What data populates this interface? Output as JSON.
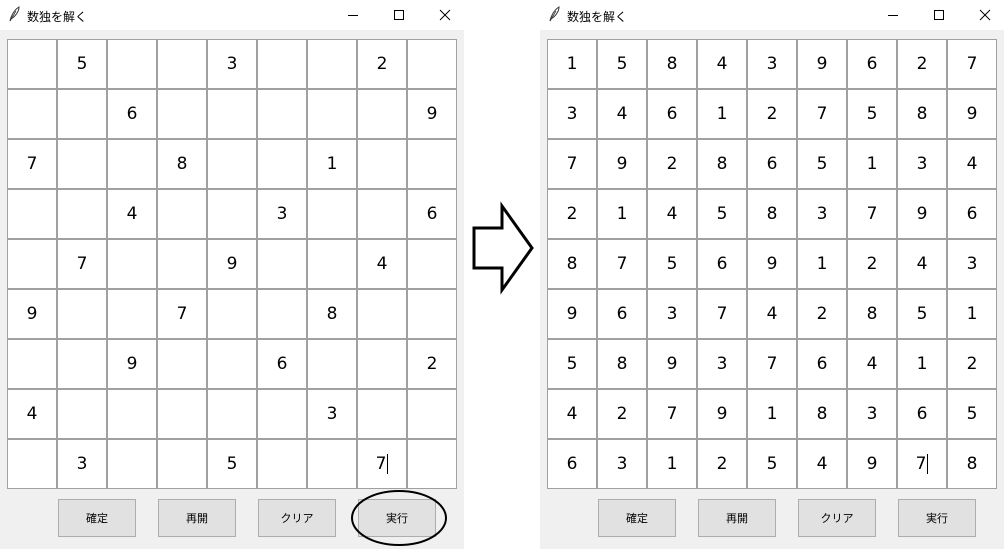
{
  "windows": [
    {
      "title": "数独を解く",
      "grid": [
        [
          "",
          "5",
          "",
          "",
          "3",
          "",
          "",
          "2",
          ""
        ],
        [
          "",
          "",
          "6",
          "",
          "",
          "",
          "",
          "",
          "9"
        ],
        [
          "7",
          "",
          "",
          "8",
          "",
          "",
          "1",
          "",
          ""
        ],
        [
          "",
          "",
          "4",
          "",
          "",
          "3",
          "",
          "",
          "6"
        ],
        [
          "",
          "7",
          "",
          "",
          "9",
          "",
          "",
          "4",
          ""
        ],
        [
          "9",
          "",
          "",
          "7",
          "",
          "",
          "8",
          "",
          ""
        ],
        [
          "",
          "",
          "9",
          "",
          "",
          "6",
          "",
          "",
          "2"
        ],
        [
          "4",
          "",
          "",
          "",
          "",
          "",
          "3",
          "",
          ""
        ],
        [
          "",
          "3",
          "",
          "",
          "5",
          "",
          "",
          "7",
          ""
        ]
      ],
      "buttons": [
        "確定",
        "再開",
        "クリア",
        "実行"
      ]
    },
    {
      "title": "数独を解く",
      "grid": [
        [
          "1",
          "5",
          "8",
          "4",
          "3",
          "9",
          "6",
          "2",
          "7"
        ],
        [
          "3",
          "4",
          "6",
          "1",
          "2",
          "7",
          "5",
          "8",
          "9"
        ],
        [
          "7",
          "9",
          "2",
          "8",
          "6",
          "5",
          "1",
          "3",
          "4"
        ],
        [
          "2",
          "1",
          "4",
          "5",
          "8",
          "3",
          "7",
          "9",
          "6"
        ],
        [
          "8",
          "7",
          "5",
          "6",
          "9",
          "1",
          "2",
          "4",
          "3"
        ],
        [
          "9",
          "6",
          "3",
          "7",
          "4",
          "2",
          "8",
          "5",
          "1"
        ],
        [
          "5",
          "8",
          "9",
          "3",
          "7",
          "6",
          "4",
          "1",
          "2"
        ],
        [
          "4",
          "2",
          "7",
          "9",
          "1",
          "8",
          "3",
          "6",
          "5"
        ],
        [
          "6",
          "3",
          "1",
          "2",
          "5",
          "4",
          "9",
          "7",
          "8"
        ]
      ],
      "buttons": [
        "確定",
        "再開",
        "クリア",
        "実行"
      ]
    }
  ],
  "text_cursor_cell": {
    "row": 8,
    "col": 7
  },
  "highlighted_button": "実行",
  "icons": {
    "app": "feather-icon",
    "minimize": "minimize-icon",
    "maximize": "maximize-icon",
    "close": "close-icon",
    "transition": "right-arrow-icon"
  },
  "colors": {
    "window_bg": "#f0f0f0",
    "cell_bg": "#ffffff",
    "cell_border": "#a0a0a0",
    "button_bg": "#e1e1e1",
    "button_border": "#adadad"
  }
}
